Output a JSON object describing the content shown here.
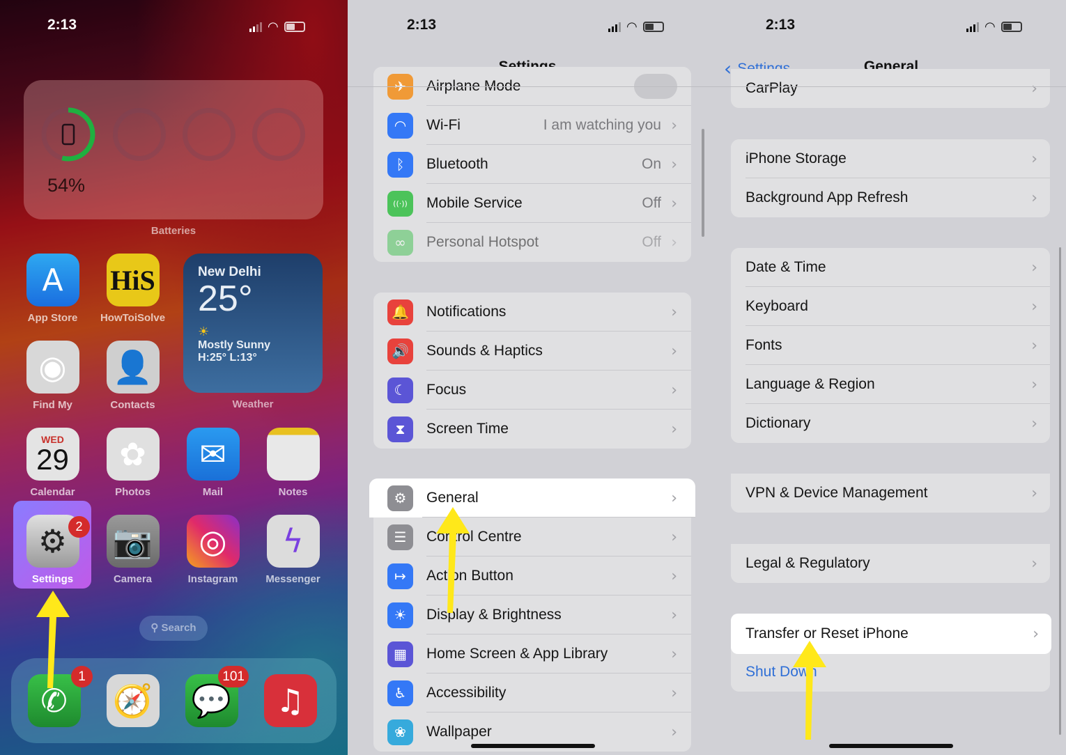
{
  "accent": "#2f6fd6",
  "arrow_color": "#ffe81a",
  "home": {
    "time": "2:13",
    "batteries_widget": {
      "percent": "54%",
      "level": 0.54,
      "label": "Batteries"
    },
    "weather_widget": {
      "city": "New Delhi",
      "temp": "25°",
      "condition": "Mostly Sunny",
      "hilo": "H:25° L:13°",
      "label": "Weather",
      "icon": "sun-icon"
    },
    "apps": [
      {
        "label": "App Store",
        "icon": "app-store-icon"
      },
      {
        "label": "HowToiSolve",
        "icon": "howtoisolve-icon",
        "logo": "HiS"
      },
      {
        "label": "Find My",
        "icon": "find-my-icon"
      },
      {
        "label": "Contacts",
        "icon": "contacts-icon"
      },
      {
        "label": "Calendar",
        "icon": "calendar-icon",
        "day": "WED",
        "date": "29"
      },
      {
        "label": "Photos",
        "icon": "photos-icon"
      },
      {
        "label": "Mail",
        "icon": "mail-icon"
      },
      {
        "label": "Notes",
        "icon": "notes-icon"
      },
      {
        "label": "Settings",
        "icon": "settings-gear-icon",
        "badge": "2"
      },
      {
        "label": "Camera",
        "icon": "camera-icon"
      },
      {
        "label": "Instagram",
        "icon": "instagram-icon"
      },
      {
        "label": "Messenger",
        "icon": "messenger-icon"
      }
    ],
    "search_label": "Search",
    "dock": [
      {
        "icon": "phone-icon",
        "badge": "1"
      },
      {
        "icon": "safari-icon"
      },
      {
        "icon": "messages-icon",
        "badge": "101"
      },
      {
        "icon": "music-icon"
      }
    ]
  },
  "settings": {
    "time": "2:13",
    "title": "Settings",
    "groups": [
      [
        {
          "label": "Airplane Mode",
          "icon": "airplane-icon",
          "color": "#f09a37",
          "toggle": true
        },
        {
          "label": "Wi-Fi",
          "icon": "wifi-icon",
          "color": "#3478f6",
          "value": "I am watching you"
        },
        {
          "label": "Bluetooth",
          "icon": "bluetooth-icon",
          "color": "#3478f6",
          "value": "On"
        },
        {
          "label": "Mobile Service",
          "icon": "antenna-icon",
          "color": "#4cc35a",
          "value": "Off"
        },
        {
          "label": "Personal Hotspot",
          "icon": "hotspot-icon",
          "color": "#4cc35a",
          "value": "Off",
          "faded": true
        }
      ],
      [
        {
          "label": "Notifications",
          "icon": "bell-icon",
          "color": "#e8423c"
        },
        {
          "label": "Sounds & Haptics",
          "icon": "speaker-icon",
          "color": "#e8423c"
        },
        {
          "label": "Focus",
          "icon": "moon-icon",
          "color": "#5b55d6"
        },
        {
          "label": "Screen Time",
          "icon": "hourglass-icon",
          "color": "#5b55d6"
        }
      ],
      [
        {
          "label": "General",
          "icon": "gear-icon",
          "color": "#8e8e93",
          "highlighted": true
        },
        {
          "label": "Control Centre",
          "icon": "toggles-icon",
          "color": "#8e8e93"
        },
        {
          "label": "Action Button",
          "icon": "action-button-icon",
          "color": "#3478f6"
        },
        {
          "label": "Display & Brightness",
          "icon": "brightness-icon",
          "color": "#3478f6"
        },
        {
          "label": "Home Screen & App Library",
          "icon": "home-grid-icon",
          "color": "#5b55d6"
        },
        {
          "label": "Accessibility",
          "icon": "accessibility-icon",
          "color": "#3478f6"
        },
        {
          "label": "Wallpaper",
          "icon": "wallpaper-icon",
          "color": "#36aadc"
        }
      ]
    ]
  },
  "general": {
    "time": "2:13",
    "back_label": "Settings",
    "title": "General",
    "groups": [
      [
        {
          "label": "CarPlay"
        }
      ],
      [
        {
          "label": "iPhone Storage"
        },
        {
          "label": "Background App Refresh"
        }
      ],
      [
        {
          "label": "Date & Time"
        },
        {
          "label": "Keyboard"
        },
        {
          "label": "Fonts"
        },
        {
          "label": "Language & Region"
        },
        {
          "label": "Dictionary"
        }
      ],
      [
        {
          "label": "VPN & Device Management"
        }
      ],
      [
        {
          "label": "Legal & Regulatory"
        }
      ],
      [
        {
          "label": "Transfer or Reset iPhone",
          "highlighted": true
        },
        {
          "label": "Shut Down",
          "link": true
        }
      ]
    ]
  }
}
